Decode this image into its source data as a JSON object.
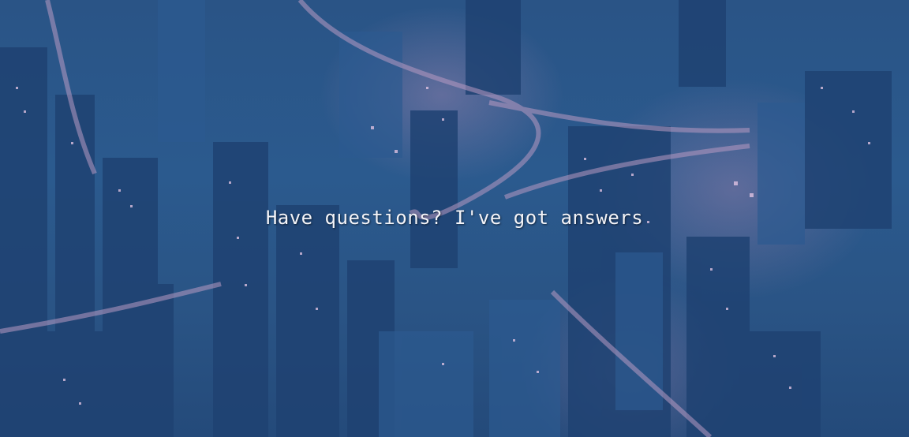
{
  "hero": {
    "heading": "Have questions? I've got answers",
    "background_image": "night-city-aerial-duotone",
    "overlay_color": "#2a5486",
    "highlight_color": "#c896be",
    "heading_color": "#f4f4f8"
  }
}
